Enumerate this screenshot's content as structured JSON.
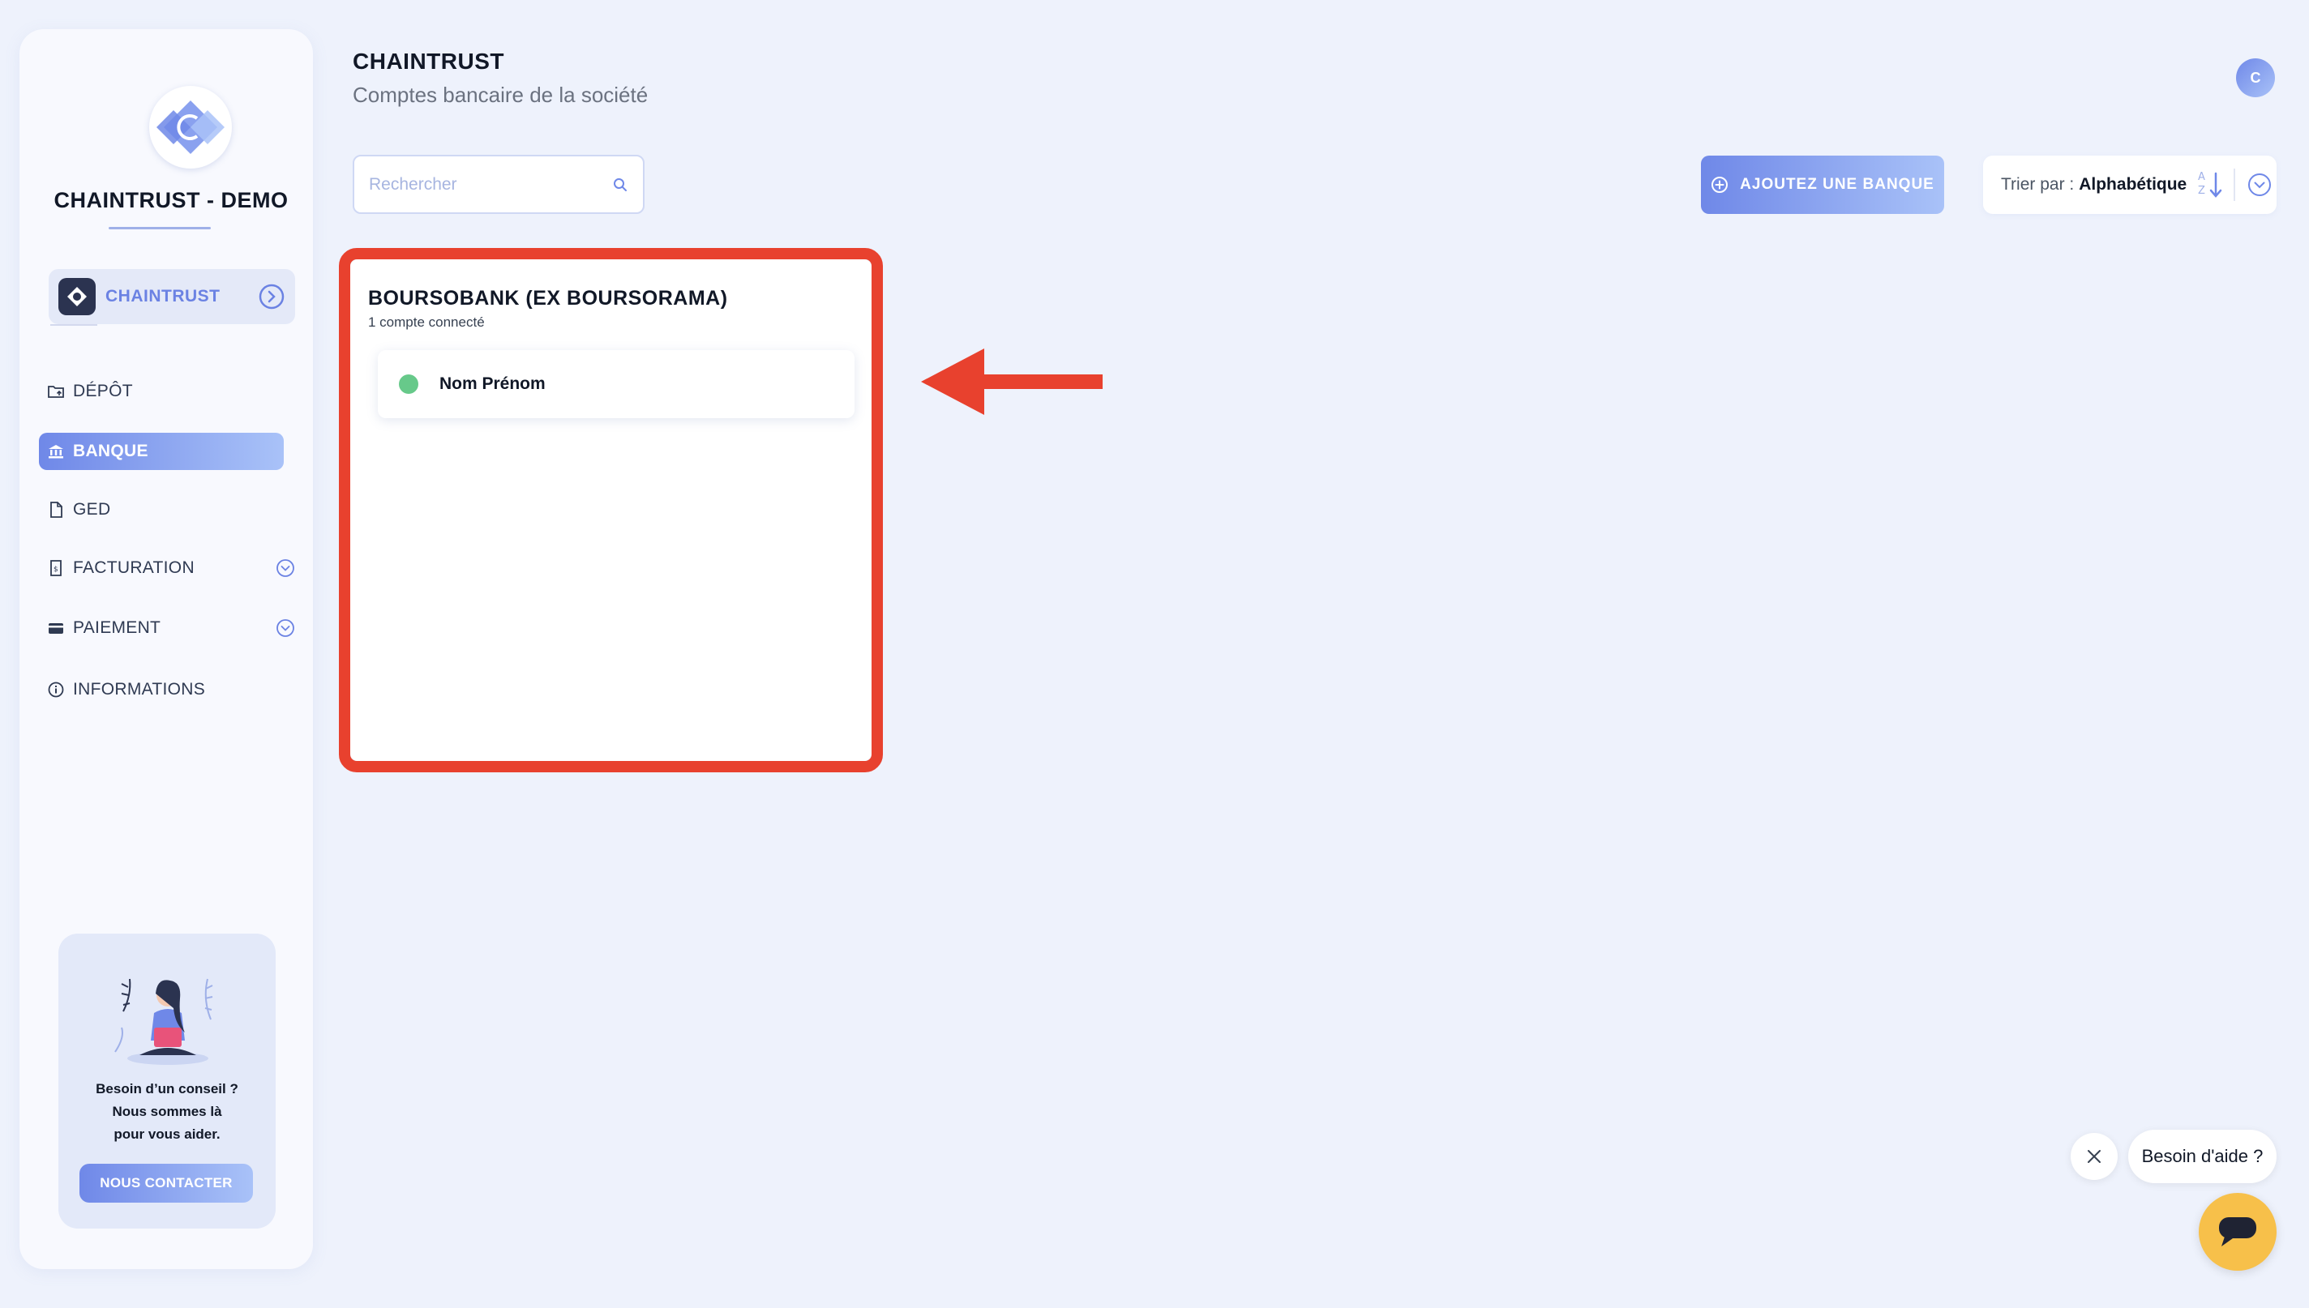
{
  "sidebar": {
    "company_name": "CHAINTRUST - DEMO",
    "org_switcher": {
      "label": "CHAINTRUST",
      "avatar_letter": "C"
    },
    "nav": [
      {
        "label": "DÉPÔT",
        "icon": "folder-upload-icon",
        "active": false
      },
      {
        "label": "BANQUE",
        "icon": "bank-icon",
        "active": true
      },
      {
        "label": "GED",
        "icon": "document-icon",
        "active": false
      },
      {
        "label": "FACTURATION",
        "icon": "invoice-icon",
        "active": false,
        "expandable": true
      },
      {
        "label": "PAIEMENT",
        "icon": "credit-card-icon",
        "active": false,
        "expandable": true
      },
      {
        "label": "INFORMATIONS",
        "icon": "info-icon",
        "active": false
      }
    ],
    "help_card": {
      "line1": "Besoin d’un conseil ?",
      "line2": "Nous sommes là",
      "line3": "pour vous aider.",
      "button": "NOUS CONTACTER"
    }
  },
  "header": {
    "title": "CHAINTRUST",
    "subtitle": "Comptes bancaire de la société",
    "user_avatar": "C"
  },
  "toolbar": {
    "search_placeholder": "Rechercher",
    "add_bank_label": "AJOUTEZ UNE BANQUE",
    "sort_prefix": "Trier par :",
    "sort_value": "Alphabétique"
  },
  "banks": [
    {
      "name": "BOURSOBANK (EX BOURSORAMA)",
      "connected_count": "1 compte connecté",
      "accounts": [
        {
          "name": "Nom Prénom",
          "status": "connected"
        }
      ]
    }
  ],
  "chat": {
    "bubble": "Besoin d'aide ?"
  },
  "colors": {
    "accent_gradient_start": "#6f88e8",
    "accent_gradient_end": "#a9c2f8",
    "highlight_red": "#e8412e",
    "status_green": "#67c98a",
    "chat_yellow": "#f7c04a"
  }
}
